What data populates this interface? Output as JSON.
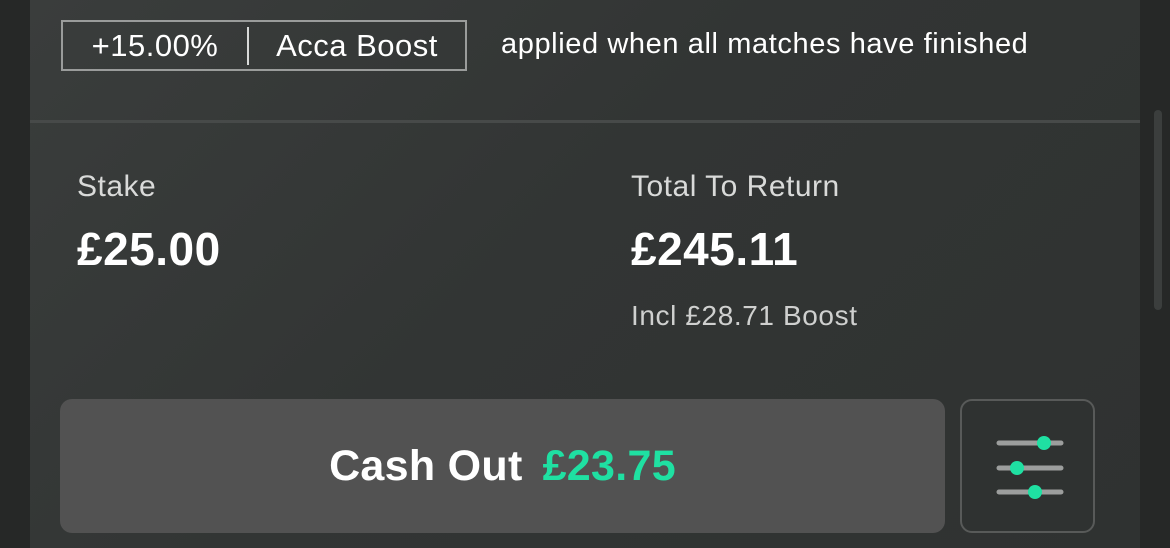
{
  "boost": {
    "percent": "+15.00%",
    "name": "Acca Boost",
    "note": "applied when all matches have finished"
  },
  "stake": {
    "label": "Stake",
    "amount": "£25.00"
  },
  "total_return": {
    "label": "Total To Return",
    "amount": "£245.11",
    "boost_note": "Incl £28.71 Boost"
  },
  "cash_out": {
    "label": "Cash Out",
    "amount": "£23.75"
  },
  "settings": {
    "icon": "sliders-icon"
  },
  "colors": {
    "accent": "#1fe0a2",
    "button_bg": "#525252",
    "card_bg": "#333635"
  }
}
